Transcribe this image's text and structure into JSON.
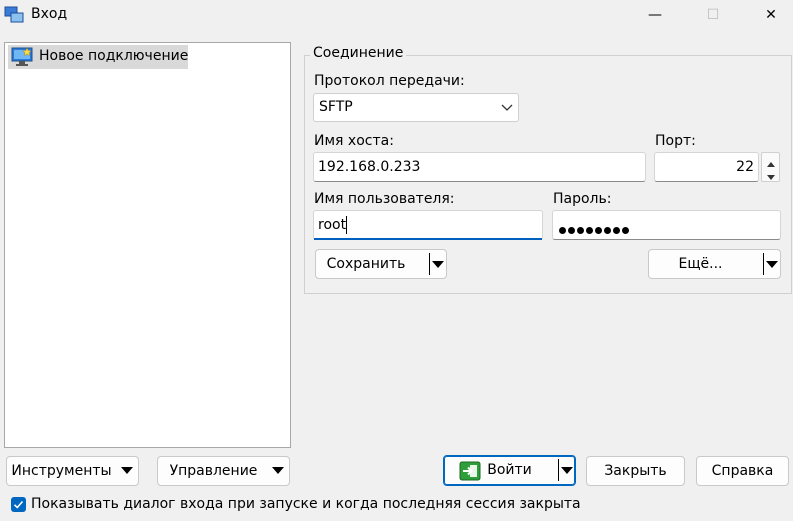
{
  "window": {
    "title": "Вход",
    "minimize_glyph": "—",
    "maximize_glyph": "☐",
    "close_glyph": "✕"
  },
  "sites": {
    "items": [
      {
        "label": "Новое подключение",
        "icon": "monitor-icon"
      }
    ]
  },
  "session": {
    "group_label": "Соединение",
    "protocol_label": "Протокол передачи:",
    "protocol_value": "SFTP",
    "host_label": "Имя хоста:",
    "host_value": "192.168.0.233",
    "port_label": "Порт:",
    "port_value": "22",
    "user_label": "Имя пользователя:",
    "user_value": "root",
    "password_label": "Пароль:",
    "password_mask_count": 8,
    "save_button": "Сохранить",
    "advanced_button": "Ещё..."
  },
  "footer": {
    "tools_button": "Инструменты",
    "manage_button": "Управление",
    "login_button": "Войти",
    "close_button": "Закрыть",
    "help_button": "Справка",
    "show_dialog_checkbox": "Показывать диалог входа при запуске и когда последняя сессия закрыта",
    "show_dialog_checked": true
  },
  "colors": {
    "accent": "#0067c0",
    "login_icon": "#2e9e3a"
  }
}
